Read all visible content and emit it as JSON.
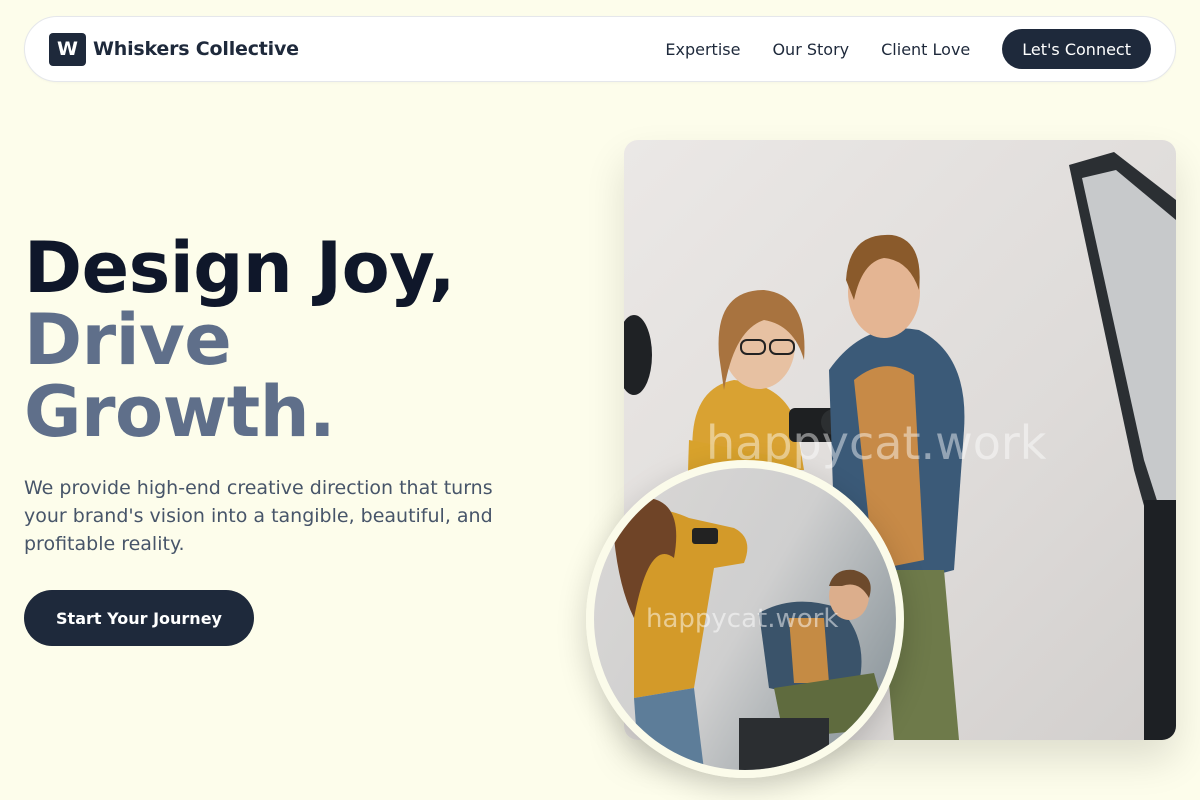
{
  "nav": {
    "logo_letter": "W",
    "brand_name": "Whiskers Collective",
    "links": [
      "Expertise",
      "Our Story",
      "Client Love"
    ],
    "cta_label": "Let's Connect"
  },
  "hero": {
    "headline_line1": "Design Joy,",
    "headline_line2": "Drive",
    "headline_line3": "Growth.",
    "subtext": "We provide high-end creative direction that turns your brand's vision into a tangible, beautiful, and profitable reality.",
    "cta_label": "Start Your Journey"
  },
  "images": {
    "main_watermark": "happycat.work",
    "circle_watermark": "happycat.work"
  },
  "colors": {
    "page_bg": "#fdfdeb",
    "dark_navy": "#1e293b",
    "accent_slate": "#5f6f8a",
    "body_text": "#475569"
  }
}
